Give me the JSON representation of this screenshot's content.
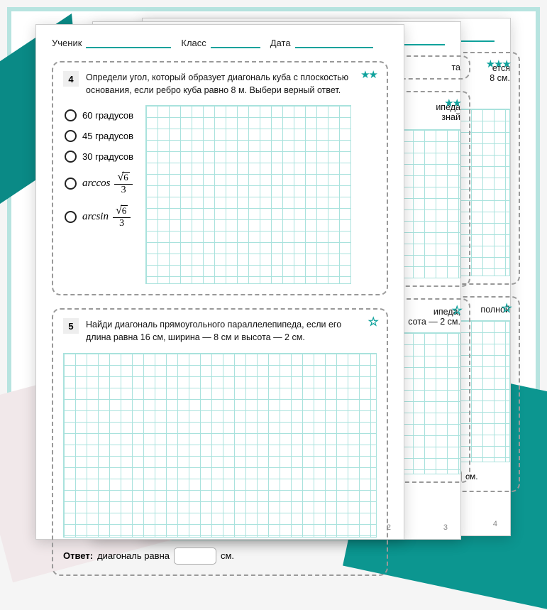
{
  "header": {
    "student_label": "Ученик",
    "class_label": "Класс",
    "date_label": "Дата"
  },
  "problem4": {
    "number": "4",
    "text": "Определи угол, который образует диагональ куба с плоскостью основания, если ребро куба равно 8 м. Выбери верный ответ.",
    "stars": "★★",
    "options": {
      "a": "60 градусов",
      "b": "45 градусов",
      "c": "30 градусов",
      "d_func": "arccos",
      "d_num": "6",
      "d_den": "3",
      "e_func": "arcsin",
      "e_num": "6",
      "e_den": "3"
    }
  },
  "problem5": {
    "number": "5",
    "text": "Найди диагональ прямоугольного параллелепипеда, если его длина равна 16 см, ширина — 8 см и высота — 2 см.",
    "star": "★",
    "answer_prefix": "Ответ:",
    "answer_tail": "диагональ равна",
    "answer_unit": "см."
  },
  "page_numbers": {
    "p2": "2",
    "p3": "3",
    "p4": "4"
  },
  "mid_page": {
    "frag1": "та",
    "frag2_a": "ипеда",
    "frag2_b": "знай",
    "frag3_a": "ипеда,",
    "frag3_b": "сота — 2 см."
  },
  "back_page": {
    "frag1_a": "ется",
    "frag1_b": "8 см.",
    "frag2": "полной",
    "ans_unit": "см."
  }
}
